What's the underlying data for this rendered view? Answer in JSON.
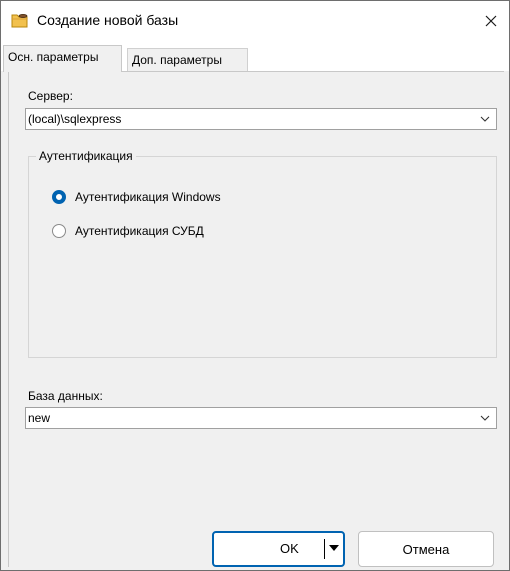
{
  "window": {
    "title": "Создание новой базы"
  },
  "tabs": [
    {
      "label": "Осн. параметры",
      "active": true
    },
    {
      "label": "Доп. параметры",
      "active": false
    }
  ],
  "server": {
    "label": "Сервер:",
    "value": "(local)\\sqlexpress"
  },
  "auth": {
    "group_title": "Аутентификация",
    "options": [
      {
        "label": "Аутентификация Windows",
        "selected": true
      },
      {
        "label": "Аутентификация СУБД",
        "selected": false
      }
    ]
  },
  "database": {
    "label": "База данных:",
    "value": "new"
  },
  "buttons": {
    "ok_label": "OK",
    "cancel_label": "Отмена"
  },
  "colors": {
    "accent": "#0063b1",
    "window_bg": "#f0f0f0"
  }
}
